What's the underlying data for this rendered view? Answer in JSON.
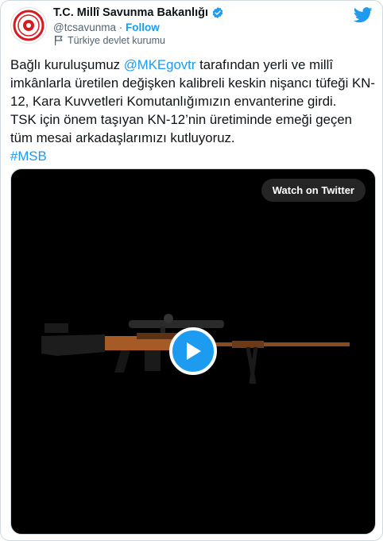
{
  "account": {
    "name": "T.C. Millî Savunma Bakanlığı",
    "handle": "@tcsavunma",
    "separator": "·",
    "follow_label": "Follow",
    "gov_label": "Türkiye devlet kurumu"
  },
  "tweet": {
    "text_part1": "Bağlı kuruluşumuz ",
    "mention": "@MKEgovtr",
    "text_part2": " tarafından yerli ve millî imkânlarla üretilen değişken kalibreli keskin nişancı tüfeği KN-12, Kara Kuvvetleri Komutanlığımızın envanterine girdi.\nTSK için önem taşıyan KN-12’nin üretiminde emeği geçen tüm mesai arkadaşlarımızı kutluyoruz.\n",
    "hashtag": "#MSB"
  },
  "media": {
    "watch_label": "Watch on Twitter"
  },
  "colors": {
    "accent": "#1d9bf0",
    "text": "#0f1419",
    "muted": "#536471",
    "emblem_red": "#d71920"
  },
  "icons": [
    "verified-badge-icon",
    "flag-icon",
    "twitter-logo-icon",
    "play-icon",
    "emblem-logo"
  ]
}
